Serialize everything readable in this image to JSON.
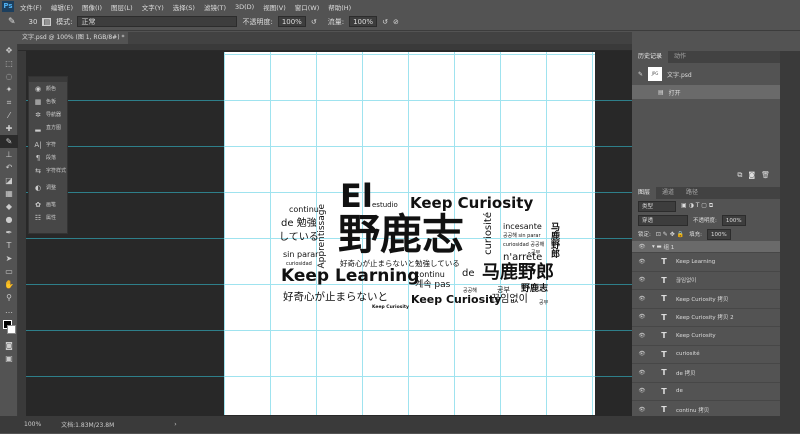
{
  "menubar": {
    "logo": "Ps",
    "items": [
      "文件(F)",
      "编辑(E)",
      "图像(I)",
      "图层(L)",
      "文字(Y)",
      "选择(S)",
      "滤镜(T)",
      "3D(D)",
      "视图(V)",
      "窗口(W)",
      "帮助(H)"
    ]
  },
  "options": {
    "brush_size": "30",
    "mode_label": "模式:",
    "mode_value": "正常",
    "opacity_label": "不透明度:",
    "opacity_value": "100%",
    "flow_label": "流量:",
    "flow_value": "100%"
  },
  "document_tab": {
    "title": "文字.psd @ 100% (图 1, RGB/8#) *",
    "close": "×"
  },
  "float_panel": {
    "items": [
      "颜色",
      "色板",
      "导航器",
      "直方图",
      "字符",
      "段落",
      "字符样式",
      "调整",
      "画笔",
      "属性"
    ]
  },
  "canvas": {
    "words": [
      "El",
      "estudio",
      "Keep Curiosity",
      "continu",
      "Apprentissage",
      "de 勉強",
      "している",
      "野鹿志",
      "curiosité",
      "incesante",
      "공공해 sin parar",
      "curiosidad 공공해",
      "공부",
      "马鹿野郎",
      "n'arrête",
      "sin parar",
      "curiosidad",
      "好奇心が止まらないと勉強している",
      "Keep Learning",
      "continu",
      "de",
      "马鹿野郎",
      "계속 pas",
      "공공해",
      "공부",
      "野鹿志",
      "好奇心が止まらないと",
      "Keep Curiosity",
      "끊임없이",
      "공부",
      "Keep Curiosity"
    ]
  },
  "history_panel": {
    "tabs": [
      "历史记录",
      "动作"
    ],
    "snapshot": "文字.psd",
    "snapshot_thumb": "JPG",
    "steps": [
      "打开"
    ]
  },
  "layers_panel": {
    "tabs": [
      "图层",
      "通道",
      "路径"
    ],
    "filter": "类型",
    "blend": "穿透",
    "opacity_label": "不透明度:",
    "opacity_value": "100%",
    "lock_label": "锁定:",
    "fill_label": "填充:",
    "fill_value": "100%",
    "group": "组 1",
    "layers": [
      "Keep Learning",
      "끊임없이",
      "Keep Curiosity 拷贝",
      "Keep Curiosity 拷贝 2",
      "Keep Curiosity",
      "curiosité",
      "de 拷贝",
      "de",
      "continu 拷贝"
    ]
  },
  "status": {
    "zoom": "100%",
    "doc": "文档:1.83M/23.8M"
  }
}
